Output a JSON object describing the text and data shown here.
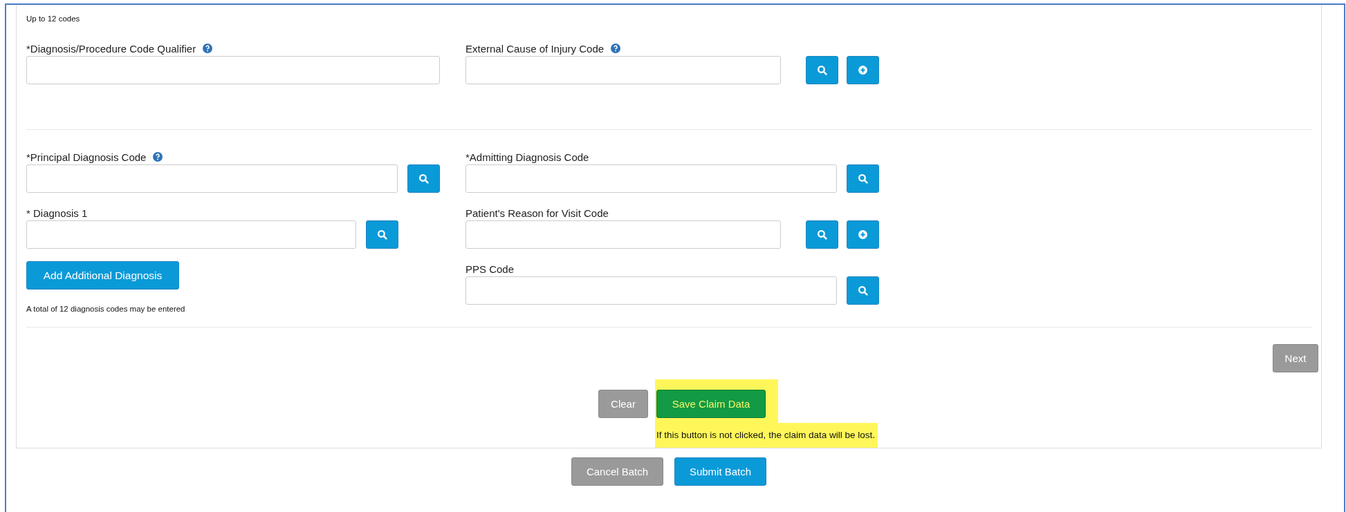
{
  "top_note": "Up to 12 codes",
  "section_1": {
    "left": [
      {
        "label": "*Diagnosis/Procedure Code Qualifier",
        "help": true,
        "kind": "full"
      }
    ],
    "right": [
      {
        "label": "External Cause of Injury Code",
        "help": true,
        "kind": "full",
        "actions": [
          {
            "kind": "search"
          },
          {
            "kind": "add"
          }
        ]
      }
    ]
  },
  "section_2": {
    "left": [
      {
        "label": "*Principal Diagnosis Code",
        "help": true,
        "kind": "lookup"
      },
      {
        "label": "* Diagnosis 1",
        "help": false,
        "kind": "short-lookup"
      }
    ],
    "add_button": "Add Additional Diagnosis",
    "limit_note": "A total of 12 diagnosis codes may be entered",
    "right": [
      {
        "label": "*Admitting Diagnosis Code",
        "help": false,
        "kind": "lookup"
      },
      {
        "label": "Patient's Reason for Visit Code",
        "help": false,
        "kind": "full",
        "actions": [
          {
            "kind": "search"
          },
          {
            "kind": "add"
          }
        ]
      },
      {
        "label": "PPS Code",
        "help": false,
        "kind": "lookup"
      }
    ]
  },
  "next_button": "Next",
  "clear_button": "Clear",
  "save_button": {
    "label": "Save Claim Data",
    "highlighted": true
  },
  "save_note": {
    "text": "If this button is not clicked, the claim data will be lost.",
    "highlighted": true
  },
  "cancel_button": "Cancel Batch",
  "submit_button": "Submit Batch"
}
